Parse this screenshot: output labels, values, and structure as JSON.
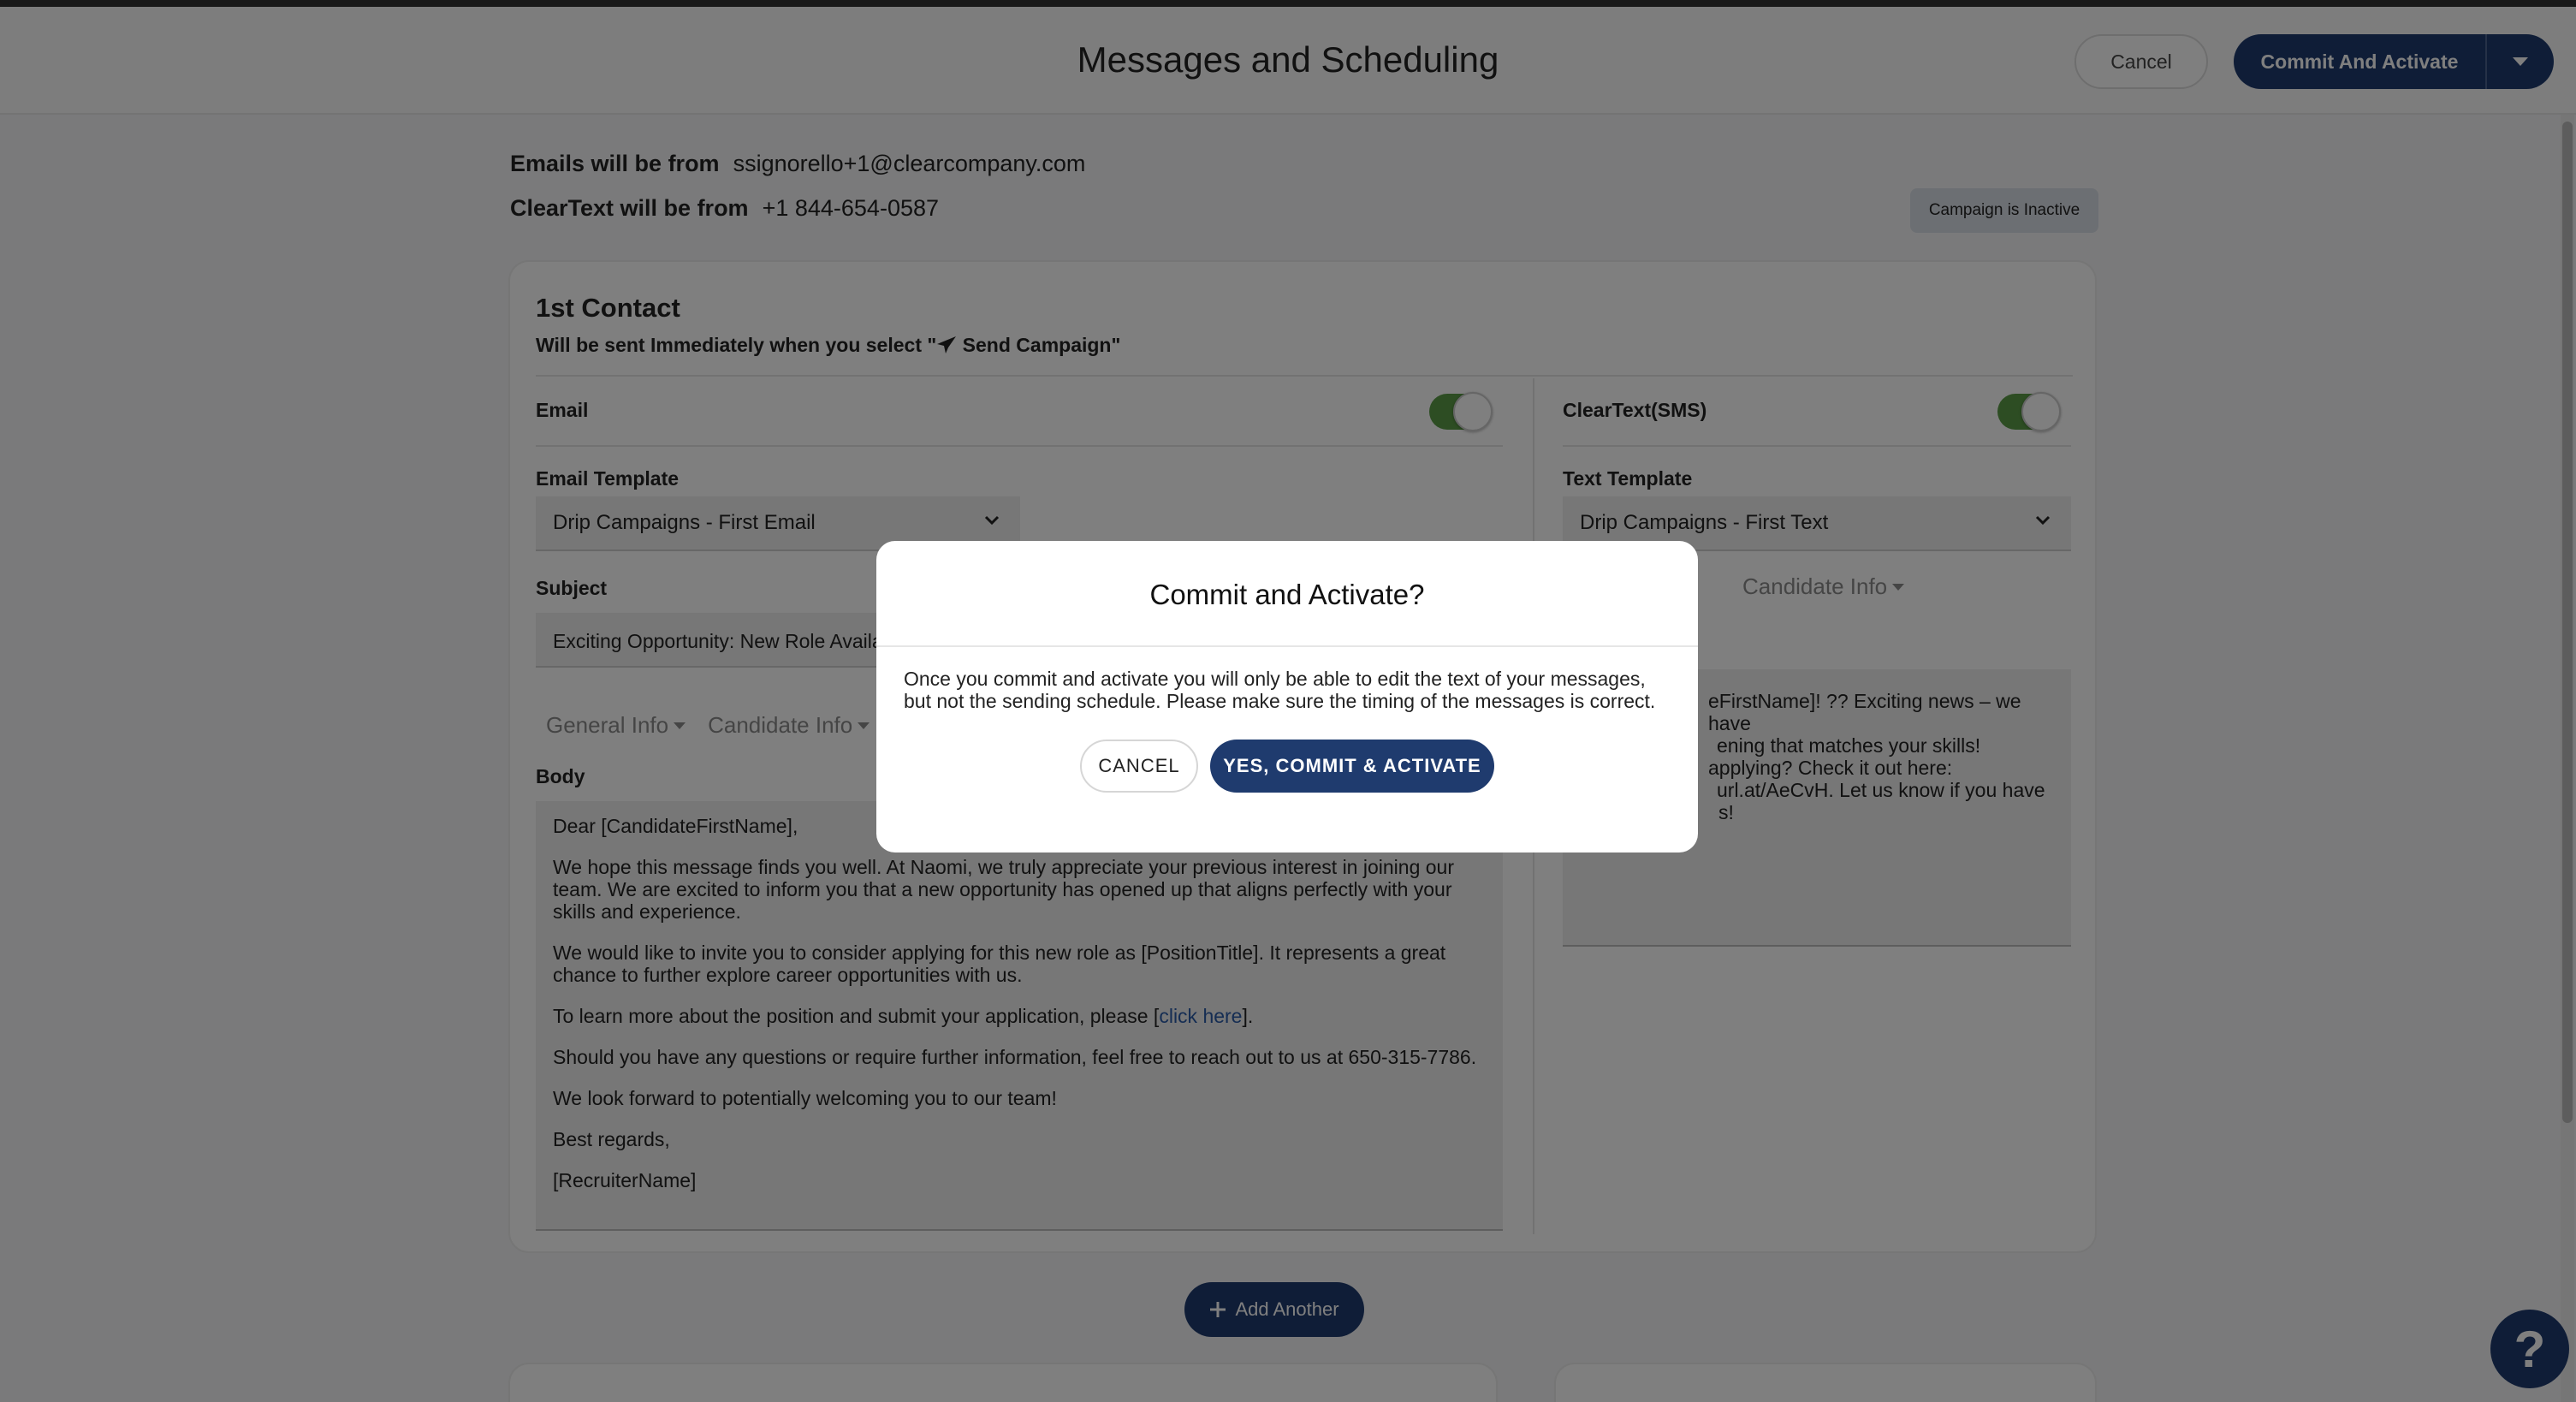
{
  "header": {
    "title": "Messages and Scheduling",
    "cancel_label": "Cancel",
    "commit_label": "Commit And Activate"
  },
  "sender": {
    "email_label": "Emails will be from",
    "email_value": "ssignorello+1@clearcompany.com",
    "text_label": "ClearText will be from",
    "text_value": "+1 844-654-0587"
  },
  "campaign_status": "Campaign is Inactive",
  "contact": {
    "title": "1st Contact",
    "subtitle_pre": "Will be sent Immediately when you select \"",
    "subtitle_post": " Send Campaign\"",
    "email": {
      "label": "Email",
      "enabled": true,
      "template_label": "Email Template",
      "template_value": "Drip Campaigns - First Email",
      "subject_label": "Subject",
      "subject_value": "Exciting Opportunity: New Role Availa",
      "menu_general": "General Info",
      "menu_candidate": "Candidate Info",
      "body_label": "Body",
      "body": {
        "p1": "Dear [CandidateFirstName],",
        "p2": "We hope this message finds you well. At Naomi, we truly appreciate your previous interest in joining our team. We are excited to inform you that a new opportunity has opened up that aligns perfectly with your skills and experience.",
        "p3": "We would like to invite you to consider applying for this new role as [PositionTitle]. It represents a great chance to further explore career opportunities with us.",
        "p4_pre": "To learn more about the position and submit your application, please [",
        "p4_link": "click here",
        "p4_post": "].",
        "p5": "Should you have any questions or require further information, feel free to reach out to us at 650-315-7786.",
        "p6": "We look forward to potentially welcoming you to our team!",
        "p7": "Best regards,",
        "p8": "[RecruiterName]"
      }
    },
    "sms": {
      "label": "ClearText(SMS)",
      "enabled": true,
      "template_label": "Text Template",
      "template_value": "Drip Campaigns - First Text",
      "menu_candidate": "Candidate Info",
      "body_l1": "eFirstName]! ?? Exciting news – we have",
      "body_l2": "ening that matches your skills!",
      "body_l3": "applying? Check it out here:",
      "body_l4": "url.at/AeCvH. Let us know if you have",
      "body_l5": "s!"
    }
  },
  "add_another_label": "Add Another",
  "help_label": "?",
  "modal": {
    "title": "Commit and Activate?",
    "text": "Once you commit and activate you will only be able to edit the text of your messages, but not the sending schedule. Please make sure the timing of the messages is correct.",
    "cancel_label": "CANCEL",
    "confirm_label": "YES, COMMIT & ACTIVATE"
  }
}
